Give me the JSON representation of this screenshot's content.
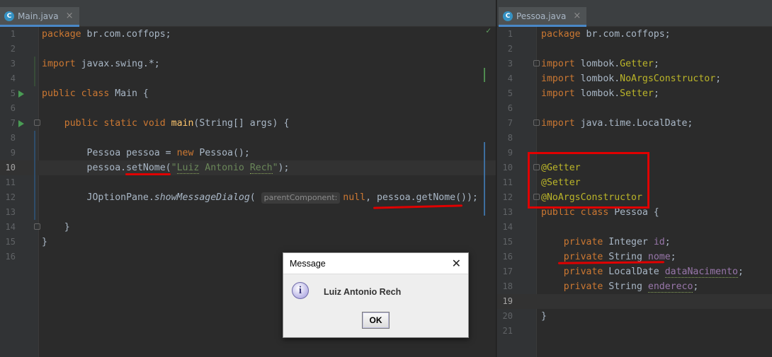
{
  "left": {
    "tab": "Main.java",
    "lines": [
      {
        "n": "1",
        "code": "package br.com.coffops;"
      },
      {
        "n": "2",
        "code": ""
      },
      {
        "n": "3",
        "code": "import javax.swing.*;"
      },
      {
        "n": "4",
        "code": ""
      },
      {
        "n": "5",
        "code": "public class Main {"
      },
      {
        "n": "6",
        "code": ""
      },
      {
        "n": "7",
        "code": "    public static void main(String[] args) {"
      },
      {
        "n": "8",
        "code": ""
      },
      {
        "n": "9",
        "code": "        Pessoa pessoa = new Pessoa();"
      },
      {
        "n": "10",
        "code": "        pessoa.setNome(\"Luiz Antonio Rech\");"
      },
      {
        "n": "11",
        "code": ""
      },
      {
        "n": "12",
        "code": "        JOptionPane.showMessageDialog( parentComponent: null, pessoa.getNome());"
      },
      {
        "n": "13",
        "code": ""
      },
      {
        "n": "14",
        "code": "    }"
      },
      {
        "n": "15",
        "code": "}"
      },
      {
        "n": "16",
        "code": ""
      }
    ],
    "param_hint": "parentComponent:"
  },
  "right": {
    "tab": "Pessoa.java",
    "lines": [
      {
        "n": "1",
        "code": "package br.com.coffops;"
      },
      {
        "n": "2",
        "code": ""
      },
      {
        "n": "3",
        "code": "import lombok.Getter;"
      },
      {
        "n": "4",
        "code": "import lombok.NoArgsConstructor;"
      },
      {
        "n": "5",
        "code": "import lombok.Setter;"
      },
      {
        "n": "6",
        "code": ""
      },
      {
        "n": "7",
        "code": "import java.time.LocalDate;"
      },
      {
        "n": "8",
        "code": ""
      },
      {
        "n": "9",
        "code": ""
      },
      {
        "n": "10",
        "code": "@Getter"
      },
      {
        "n": "11",
        "code": "@Setter"
      },
      {
        "n": "12",
        "code": "@NoArgsConstructor"
      },
      {
        "n": "13",
        "code": "public class Pessoa {"
      },
      {
        "n": "14",
        "code": ""
      },
      {
        "n": "15",
        "code": "    private Integer id;"
      },
      {
        "n": "16",
        "code": "    private String nome;"
      },
      {
        "n": "17",
        "code": "    private LocalDate dataNacimento;"
      },
      {
        "n": "18",
        "code": "    private String endereco;"
      },
      {
        "n": "19",
        "code": ""
      },
      {
        "n": "20",
        "code": "}"
      },
      {
        "n": "21",
        "code": ""
      }
    ]
  },
  "dialog": {
    "title": "Message",
    "message": "Luiz Antonio Rech",
    "ok": "OK",
    "icon": "info-icon"
  },
  "colors": {
    "editor_bg": "#2b2b2b",
    "keyword": "#cc7832",
    "string": "#6a8759",
    "annotation": "#bbb529",
    "field": "#9876aa",
    "highlight_red": "#e00000"
  }
}
